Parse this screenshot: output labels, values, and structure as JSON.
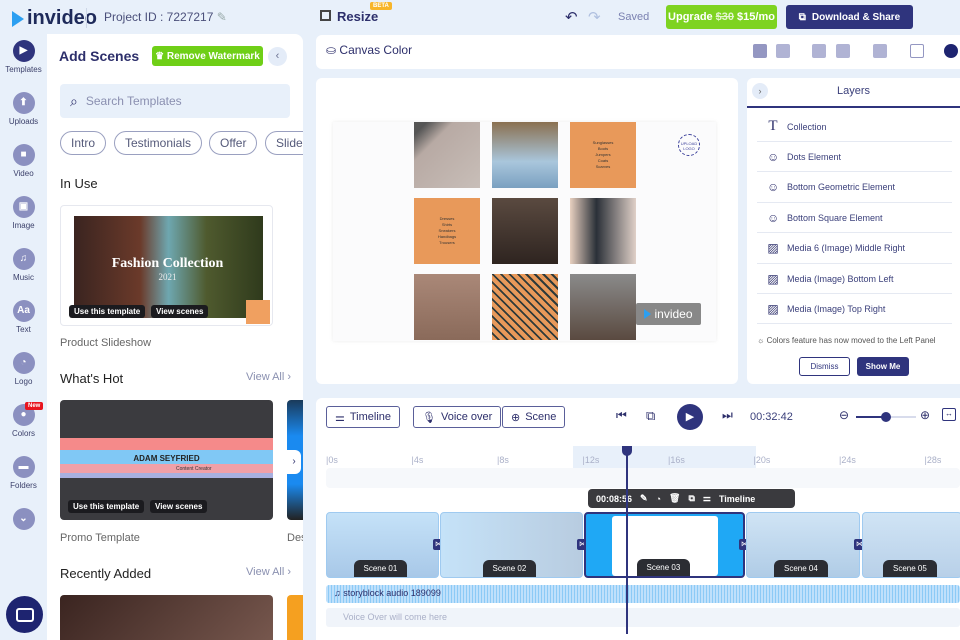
{
  "header": {
    "brand": "invideo",
    "project_id": "Project ID : 7227217",
    "resize": "Resize",
    "beta": "BETA",
    "saved": "Saved",
    "upgrade": "Upgrade",
    "old_price": "$30",
    "new_price": "$15/mo",
    "download": "Download & Share"
  },
  "rail": [
    {
      "label": "Templates",
      "glyph": "▶"
    },
    {
      "label": "Uploads",
      "glyph": "⬆"
    },
    {
      "label": "Video",
      "glyph": "■"
    },
    {
      "label": "Image",
      "glyph": "▣"
    },
    {
      "label": "Music",
      "glyph": "♫"
    },
    {
      "label": "Text",
      "glyph": "Aa"
    },
    {
      "label": "Logo",
      "glyph": "◔"
    },
    {
      "label": "Colors",
      "glyph": "●"
    },
    {
      "label": "Folders",
      "glyph": "▬"
    },
    {
      "label": "",
      "glyph": "⌄"
    }
  ],
  "rail_new": "New",
  "panel": {
    "title": "Add Scenes",
    "remove_watermark": "Remove Watermark",
    "search_placeholder": "Search Templates",
    "chips": [
      "Intro",
      "Testimonials",
      "Offer",
      "Slide"
    ],
    "in_use": "In Use",
    "in_use_card": {
      "title": "Fashion Collection",
      "year": "2021",
      "use": "Use this template",
      "view": "View scenes",
      "caption": "Product Slideshow"
    },
    "whats_hot": "What's Hot",
    "view_all": "View All ›",
    "hot_card": {
      "name": "ADAM SEYFRIED",
      "role": "Content Creator",
      "use": "Use this template",
      "view": "View scenes",
      "caption": "Promo Template",
      "next_caption": "Des"
    },
    "recently_added": "Recently Added"
  },
  "toolbar": {
    "canvas_color": "Canvas Color"
  },
  "canvas": {
    "list1": [
      "Sunglasses",
      "Boots",
      "Jumpers",
      "Coats",
      "Scarves"
    ],
    "list2": [
      "Dresses",
      "Shirts",
      "Sneakers",
      "Handbags",
      "Trousers"
    ],
    "upload_logo": "UPLOAD LOGO",
    "watermark": "invideo"
  },
  "layers": {
    "title": "Layers",
    "items": [
      {
        "icon": "T",
        "label": "Collection"
      },
      {
        "icon": "☺",
        "label": "Dots Element"
      },
      {
        "icon": "☺",
        "label": "Bottom Geometric Element"
      },
      {
        "icon": "☺",
        "label": "Bottom Square Element"
      },
      {
        "icon": "▨",
        "label": "Media 6 (Image) Middle Right"
      },
      {
        "icon": "▨",
        "label": "Media (Image) Bottom Left"
      },
      {
        "icon": "▨",
        "label": "Media (Image) Top Right"
      }
    ],
    "notice": "Colors feature has now moved to the Left Panel",
    "dismiss": "Dismiss",
    "show_me": "Show Me"
  },
  "timeline": {
    "timeline_btn": "Timeline",
    "voice_btn": "Voice over",
    "scene_btn": "Scene",
    "time": "00:32:42",
    "zoom_level": 0.5,
    "ticks": [
      "0s",
      "4s",
      "8s",
      "12s",
      "16s",
      "20s",
      "24s",
      "28s"
    ],
    "popup": {
      "duration": "00:08:56",
      "timeline": "Timeline"
    },
    "scenes": [
      "Scene 01",
      "Scene 02",
      "Scene 03",
      "Scene 04",
      "Scene 05"
    ],
    "audio": "storyblock audio 189099",
    "voice_placeholder": "Voice Over will come here"
  }
}
